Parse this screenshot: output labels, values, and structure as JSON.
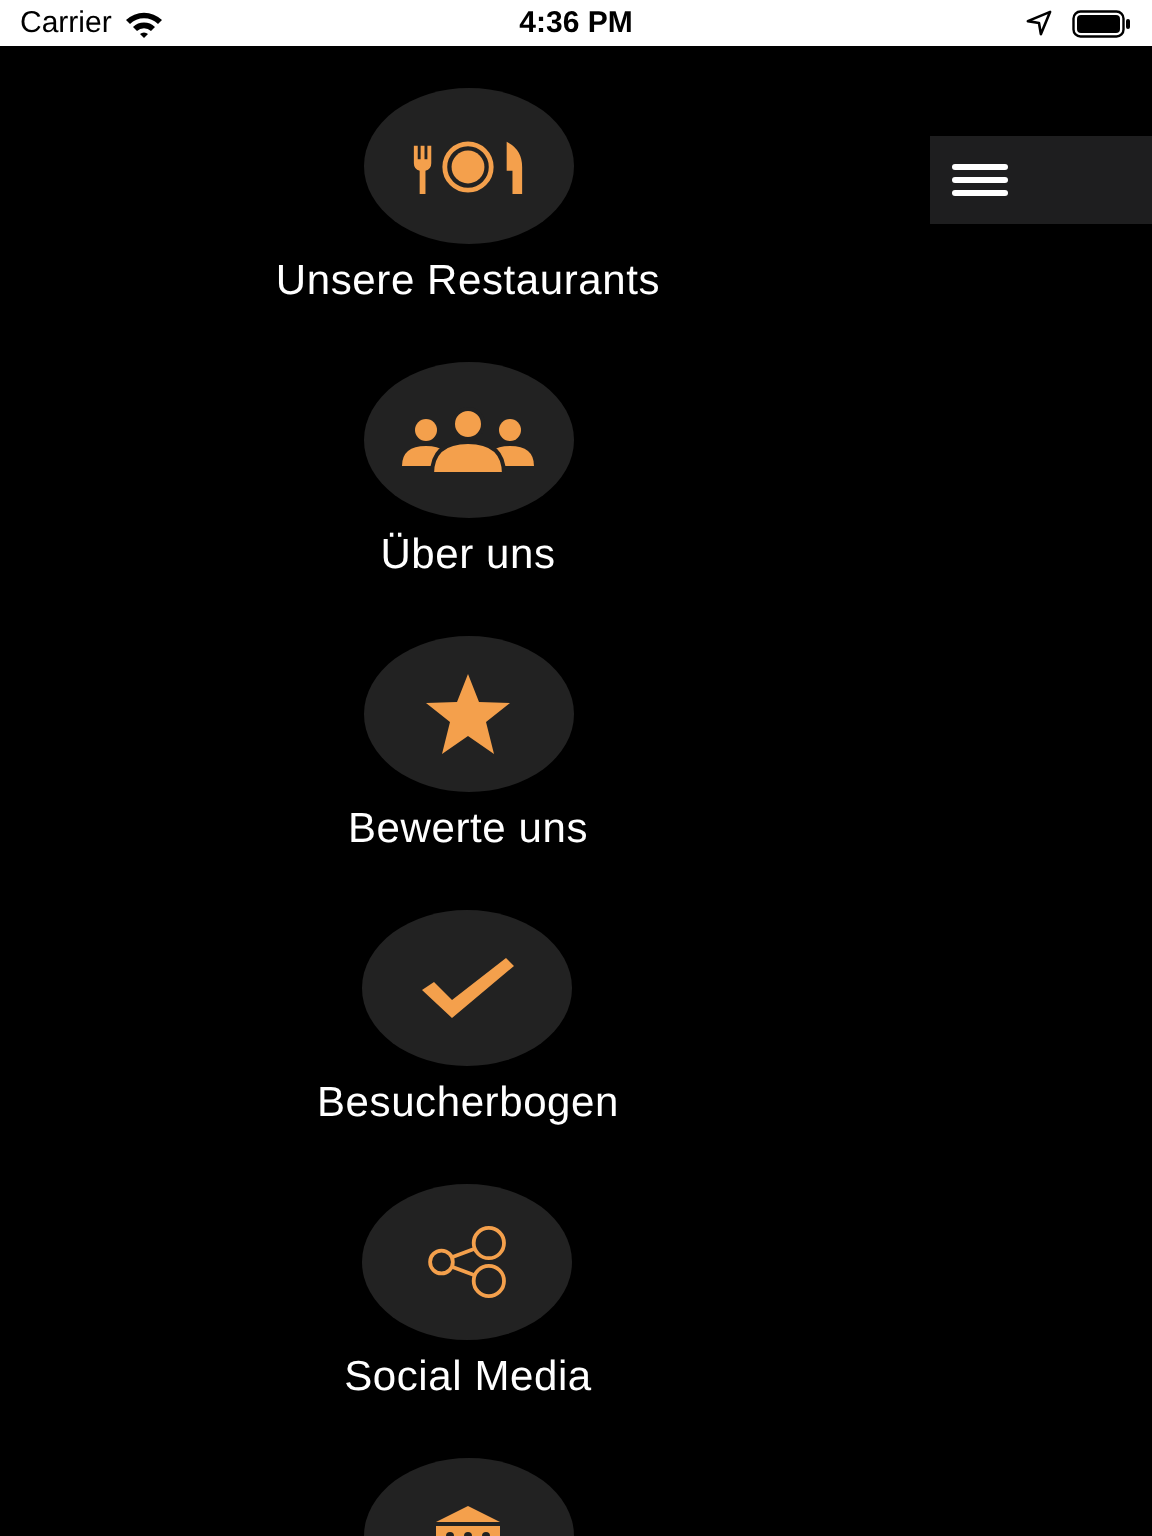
{
  "status_bar": {
    "carrier": "Carrier",
    "time": "4:36 PM"
  },
  "menu_items": [
    {
      "kind": "dining",
      "label": "Unsere Restaurants"
    },
    {
      "kind": "people",
      "label": "Über uns"
    },
    {
      "kind": "star",
      "label": "Bewerte uns"
    },
    {
      "kind": "check",
      "label": "Besucherbogen"
    },
    {
      "kind": "share",
      "label": "Social Media"
    },
    {
      "kind": "building"
    }
  ]
}
